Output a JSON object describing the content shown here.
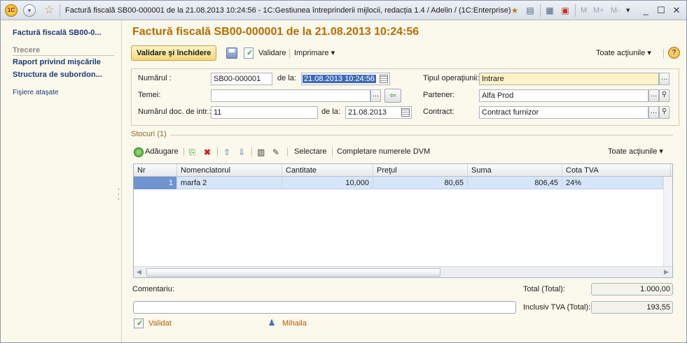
{
  "titlebar": {
    "logo_text": "1C",
    "title": "Factură fiscală SB00-000001 de la 21.08.2013 10:24:56 - 1C:Gestiunea întreprinderii mijlocii, redacția 1.4 / Adelin /  (1C:Enterprise)",
    "memory_buttons": [
      "M",
      "M+",
      "M-"
    ],
    "window_controls": [
      "_",
      "☐",
      "✕"
    ]
  },
  "sidebar": {
    "items": [
      {
        "label": "Factură fiscală SB00-0..."
      }
    ],
    "section_title": "Trecere",
    "section_items": [
      {
        "label": "Raport privind mişcările"
      },
      {
        "label": "Structura de subordon..."
      }
    ],
    "attached_files": "Fişiere ataşate"
  },
  "document": {
    "title": "Factură fiscală SB00-000001 de la 21.08.2013 10:24:56"
  },
  "toolbar": {
    "validate_close": "Validare şi închidere",
    "validate": "Validare",
    "print": "Imprimare",
    "all_actions": "Toate acţiunile",
    "help": "?"
  },
  "header": {
    "number_label": "Numărul :",
    "number_value": "SB00-000001",
    "date_label": "de la:",
    "date_value": "21.08.2013 10:24:56",
    "operation_type_label": "Tipul operaţiunii:",
    "operation_type_value": "Intrare",
    "basis_label": "Temei:",
    "basis_value": "",
    "partner_label": "Partener:",
    "partner_value": "Alfa Prod",
    "entry_doc_label": "Numărul doc. de intr.:",
    "entry_doc_value": "11",
    "entry_date_label": "de la:",
    "entry_date_value": "21.08.2013",
    "contract_label": "Contract:",
    "contract_value": "Contract furnizor"
  },
  "stock": {
    "group_title": "Stocuri",
    "count": "(1)",
    "add": "Adăugare",
    "select": "Selectare",
    "fill_dvm": "Completare numerele DVM",
    "all_actions": "Toate acţiunile",
    "columns": [
      "Nr",
      "Nomenclatorul",
      "Cantitate",
      "Preţul",
      "Suma",
      "Cota TVA"
    ],
    "rows": [
      {
        "nr": "1",
        "item": "marfa 2",
        "quantity": "10,000",
        "price": "80,65",
        "sum": "806,45",
        "vat": "24%"
      }
    ]
  },
  "footer": {
    "comment_label": "Comentariu:",
    "comment_value": "",
    "total_label": "Total (Total):",
    "total_value": "1.000,00",
    "vat_total_label": "Inclusiv TVA (Total):",
    "vat_total_value": "193,55",
    "status": "Validat",
    "user": "Mihaila"
  }
}
